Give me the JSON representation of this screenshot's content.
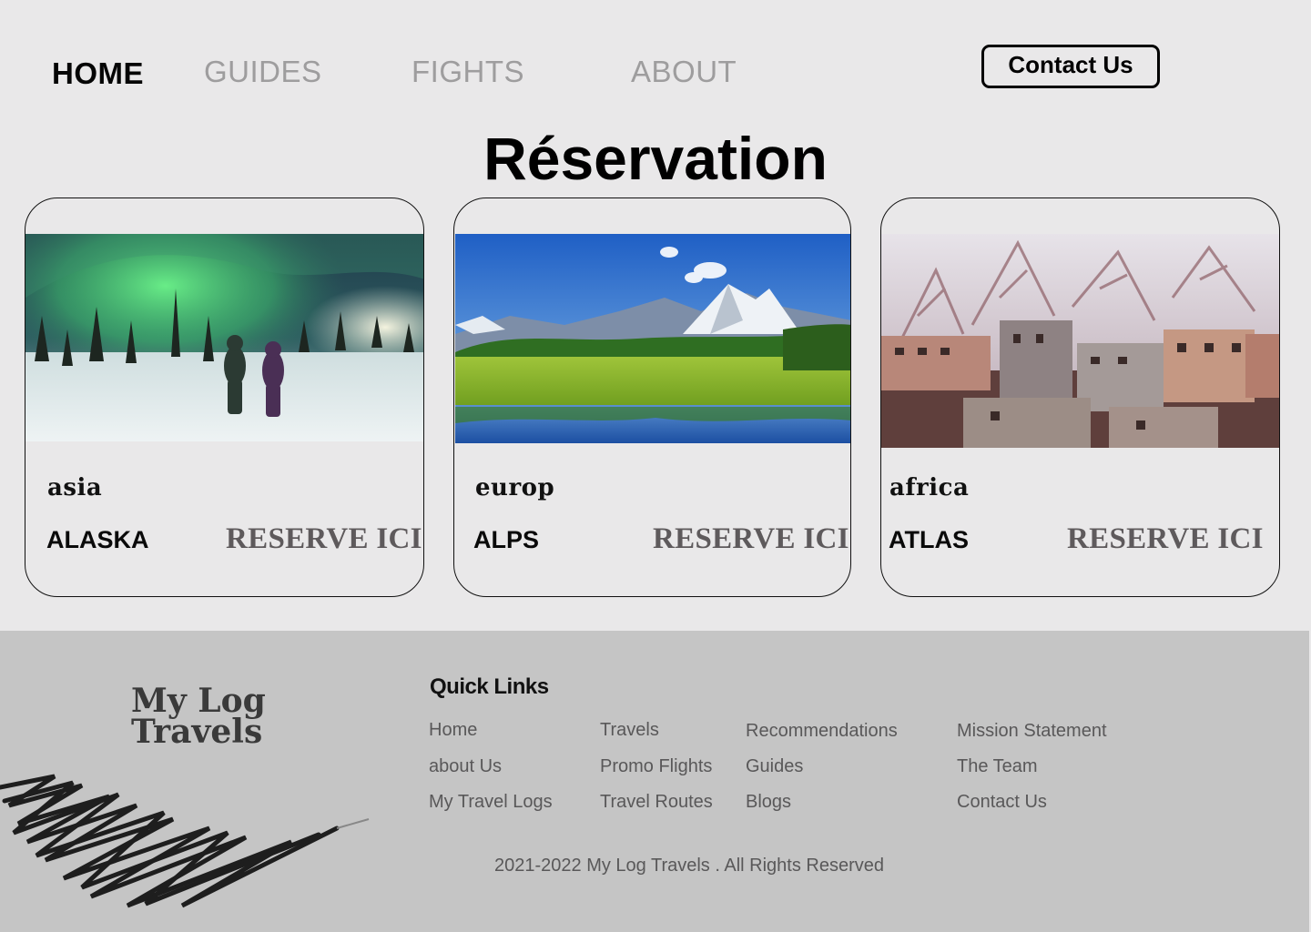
{
  "nav": {
    "items": [
      {
        "label": "HOME",
        "active": true
      },
      {
        "label": "GUIDES",
        "active": false
      },
      {
        "label": "FIGHTS",
        "active": false
      },
      {
        "label": "ABOUT",
        "active": false
      }
    ],
    "contact_label": "Contact Us"
  },
  "page": {
    "title": "Réservation"
  },
  "cards": [
    {
      "region": "asia",
      "place": "ALASKA",
      "reserve_label": "RESERVE ICI",
      "image": "northern-lights-snow-photo"
    },
    {
      "region": "europ",
      "place": "ALPS",
      "reserve_label": "RESERVE ICI",
      "image": "alpine-lake-mountain-photo"
    },
    {
      "region": "africa",
      "place": "ATLAS",
      "reserve_label": "RESERVE ICI",
      "image": "atlas-mountain-village-photo"
    }
  ],
  "footer": {
    "logo_line1": "My Log",
    "logo_line2": "Travels",
    "quick_links_heading": "Quick Links",
    "columns": [
      [
        "Home",
        "about Us",
        "My Travel Logs"
      ],
      [
        "Travels",
        "Promo Flights",
        "Travel Routes"
      ],
      [
        "Recommendations",
        "Guides",
        "Blogs"
      ],
      [
        "Mission Statement",
        "The Team",
        "Contact Us"
      ]
    ],
    "copyright": "2021-2022 My Log Travels . All Rights Reserved"
  },
  "colors": {
    "background": "#e9e8e9",
    "footer_background": "#c5c5c5",
    "nav_inactive": "#9e9d9e",
    "reserve_text": "#5e5a5c"
  }
}
